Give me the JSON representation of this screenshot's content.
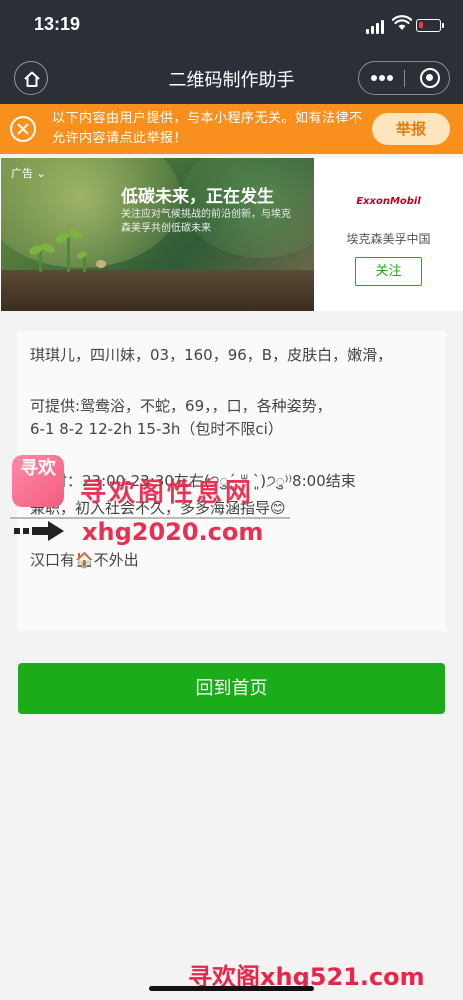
{
  "status_bar": {
    "time": "13:19"
  },
  "nav": {
    "title": "二维码制作助手",
    "home_icon": "home-icon",
    "more_icon": "more-dots-icon",
    "close_icon": "close-miniprogram-icon"
  },
  "notice": {
    "text": "以下内容由用户提供，与本小程序无关。如有法律不允许内容请点此举报！",
    "report_label": "举报",
    "color": "#f98f1d"
  },
  "ad": {
    "tag": "广告",
    "headline": "低碳未来，正在发生",
    "subline": "关注应对气候挑战的前沿创新，与埃克森美孚共创低碳未来",
    "logo_text": "ExxonMobil",
    "brand": "埃克森美孚中国",
    "follow_label": "关注"
  },
  "content": {
    "line1": "琪琪儿，四川妹，03，160，96，B，皮肤白，嫩滑，",
    "line2": "可提供:鸳鸯浴，不蛇，69，，口，各种姿势，",
    "line3": "6-1 8-2 12-2h 15-3h（包时不限ci）",
    "line4": "时：23:00-23:30左右(੭ु´͈ ᐜ `͈)੭ु⁾⁾8:00结束",
    "line5": "兼职，初入社会不久，多多海涵指导😊",
    "line6": "汉口有🏠不外出"
  },
  "watermark": {
    "logo_text": "寻欢",
    "title": "寻欢阁性息网",
    "url": "xhg2020.com",
    "bottom": "寻欢阁xhg521.com"
  },
  "button": {
    "home_label": "回到首页",
    "color": "#1aad19"
  }
}
